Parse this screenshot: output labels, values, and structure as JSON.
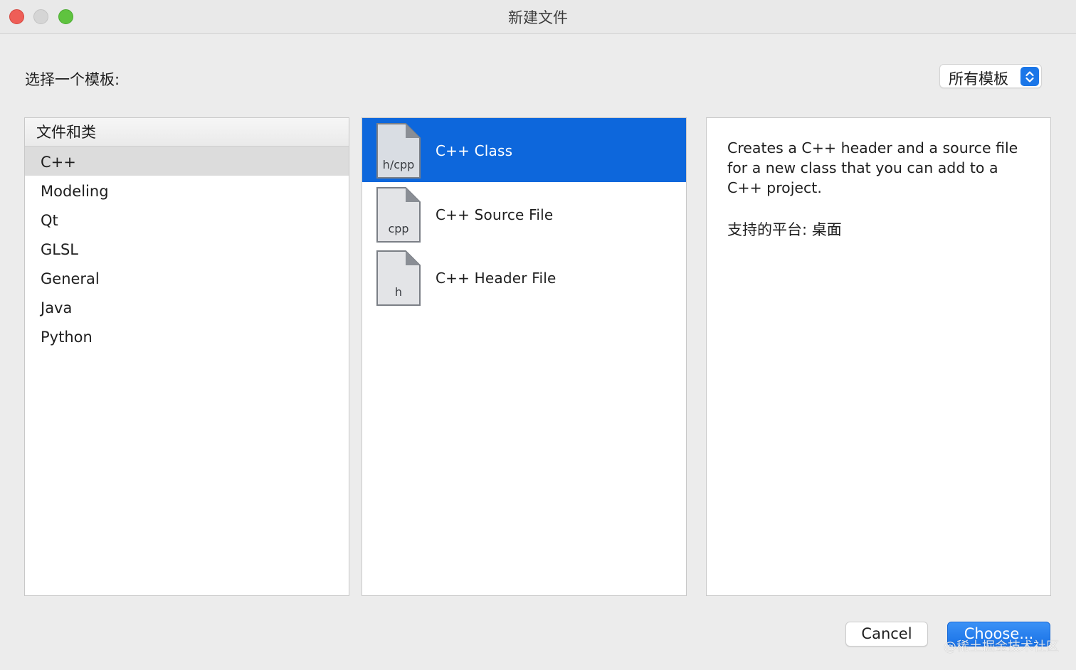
{
  "window": {
    "title": "新建文件"
  },
  "prompt": {
    "label": "选择一个模板:"
  },
  "filter_select": {
    "value": "所有模板"
  },
  "categories": {
    "header": "文件和类",
    "items": [
      {
        "label": "C++",
        "selected": true
      },
      {
        "label": "Modeling",
        "selected": false
      },
      {
        "label": "Qt",
        "selected": false
      },
      {
        "label": "GLSL",
        "selected": false
      },
      {
        "label": "General",
        "selected": false
      },
      {
        "label": "Java",
        "selected": false
      },
      {
        "label": "Python",
        "selected": false
      }
    ]
  },
  "templates": {
    "items": [
      {
        "label": "C++ Class",
        "icon_text": "h/cpp",
        "icon": "file-hcpp-icon",
        "selected": true
      },
      {
        "label": "C++ Source File",
        "icon_text": "cpp",
        "icon": "file-cpp-icon",
        "selected": false
      },
      {
        "label": "C++ Header File",
        "icon_text": "h",
        "icon": "file-h-icon",
        "selected": false
      }
    ]
  },
  "description": {
    "text": "Creates a C++ header and a source file for a new class that you can add to a C++ project.",
    "platforms": "支持的平台: 桌面"
  },
  "buttons": {
    "cancel": "Cancel",
    "choose": "Choose..."
  },
  "watermark": "@稀土掘金技术社区",
  "colors": {
    "selection": "#0d67dc",
    "category_selection": "#dcdcdc",
    "accent_button": "#1a72e6",
    "close": "#ee5e57",
    "zoom": "#5fc33f"
  }
}
